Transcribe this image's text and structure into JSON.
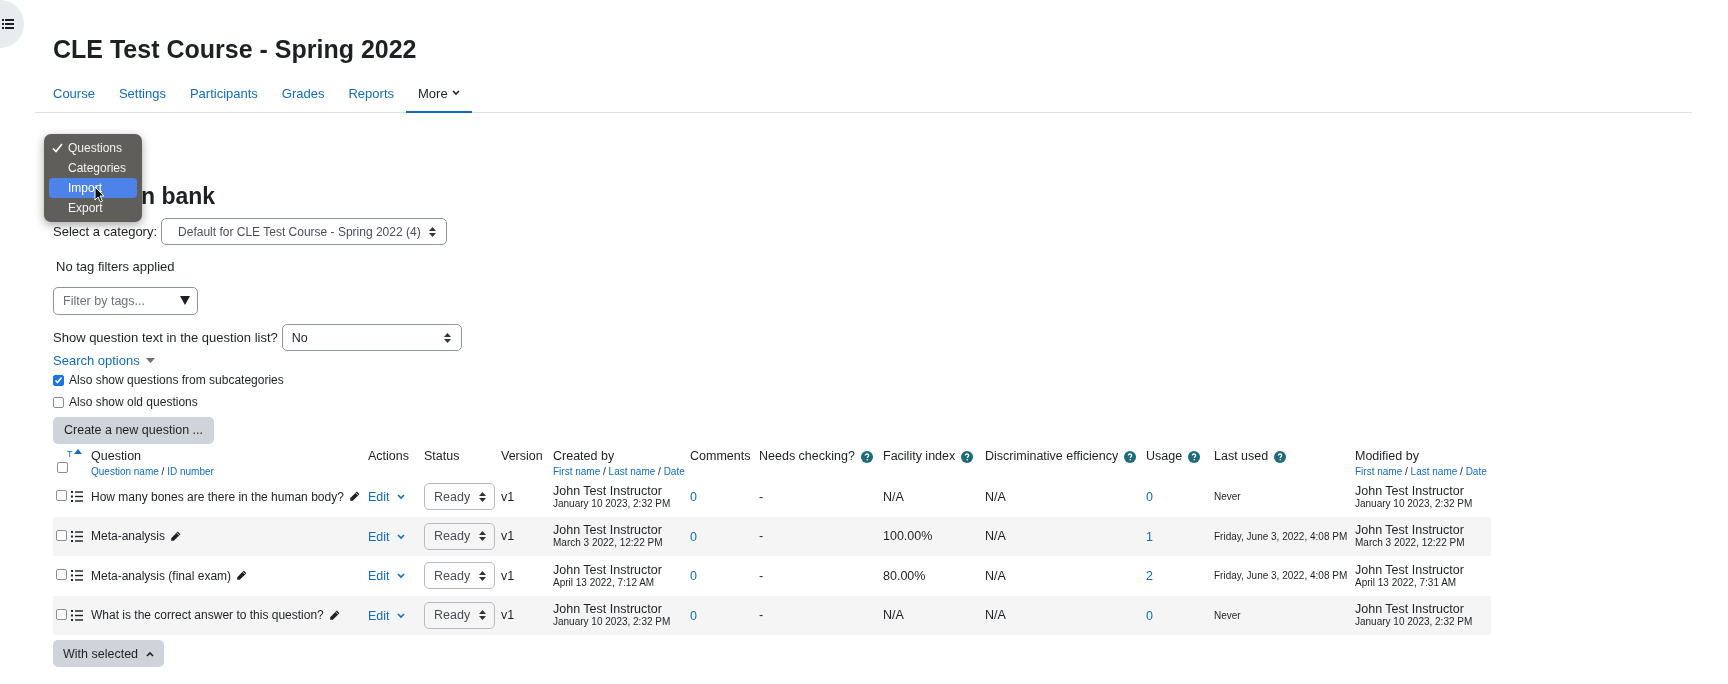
{
  "course_title": "CLE Test Course - Spring 2022",
  "nav_tabs": [
    {
      "label": "Course",
      "selected": false,
      "kind": "link"
    },
    {
      "label": "Settings",
      "selected": false,
      "kind": "link"
    },
    {
      "label": "Participants",
      "selected": false,
      "kind": "link"
    },
    {
      "label": "Grades",
      "selected": false,
      "kind": "link"
    },
    {
      "label": "Reports",
      "selected": false,
      "kind": "link"
    },
    {
      "label": "More",
      "selected": true,
      "kind": "dropdown"
    }
  ],
  "page_menu": [
    {
      "label": "Questions",
      "checked": true,
      "selected": false
    },
    {
      "label": "Categories",
      "checked": false,
      "selected": false
    },
    {
      "label": "Import",
      "checked": false,
      "selected": true
    },
    {
      "label": "Export",
      "checked": false,
      "selected": false
    }
  ],
  "heading": "n bank",
  "category": {
    "label": "Select a category:",
    "value": "Default for CLE Test Course - Spring 2022 (4)"
  },
  "tag_filter_note": "No tag filters applied",
  "tag_filter": {
    "placeholder": "Filter by tags..."
  },
  "show_text": {
    "label": "Show question text in the question list?",
    "value": "No"
  },
  "search_options": "Search options",
  "options": [
    {
      "label": "Also show questions from subcategories",
      "checked": true
    },
    {
      "label": "Also show old questions",
      "checked": false
    }
  ],
  "create_button": "Create a new question ...",
  "table": {
    "sort_mark": "T",
    "all_checked": false,
    "separator": "/",
    "columns": [
      {
        "label": "Question",
        "sublinks": [
          "Question name",
          "ID number"
        ],
        "help": false
      },
      {
        "label": "Actions",
        "help": false
      },
      {
        "label": "Status",
        "help": false
      },
      {
        "label": "Version",
        "help": false
      },
      {
        "label": "Created by",
        "sublinks": [
          "First name",
          "Last name",
          "Date"
        ],
        "help": false
      },
      {
        "label": "Comments",
        "help": false
      },
      {
        "label": "Needs checking?",
        "help": true
      },
      {
        "label": "Facility index",
        "help": true
      },
      {
        "label": "Discriminative efficiency",
        "help": true
      },
      {
        "label": "Usage",
        "help": true
      },
      {
        "label": "Last used",
        "help": true
      },
      {
        "label": "Modified by",
        "sublinks": [
          "First name",
          "Last name",
          "Date"
        ],
        "help": false
      }
    ],
    "rows": [
      {
        "selected": false,
        "name": "How many bones are there in the human body?",
        "action": "Edit",
        "status": "Ready",
        "version": "v1",
        "created_name": "John Test Instructor",
        "created_date": "January 10 2023, 2:32 PM",
        "comments": "0",
        "needs_checking": "-",
        "facility": "N/A",
        "discrimination": "N/A",
        "usage": "0",
        "last_used": "Never",
        "modified_name": "John Test Instructor",
        "modified_date": "January 10 2023, 2:32 PM"
      },
      {
        "selected": false,
        "name": "Meta-analysis",
        "action": "Edit",
        "status": "Ready",
        "version": "v1",
        "created_name": "John Test Instructor",
        "created_date": "March 3 2022, 12:22 PM",
        "comments": "0",
        "needs_checking": "-",
        "facility": "100.00%",
        "discrimination": "N/A",
        "usage": "1",
        "last_used": "Friday, June 3, 2022, 4:08 PM",
        "modified_name": "John Test Instructor",
        "modified_date": "March 3 2022, 12:22 PM"
      },
      {
        "selected": false,
        "name": "Meta-analysis (final exam)",
        "action": "Edit",
        "status": "Ready",
        "version": "v1",
        "created_name": "John Test Instructor",
        "created_date": "April 13 2022, 7:12 AM",
        "comments": "0",
        "needs_checking": "-",
        "facility": "80.00%",
        "discrimination": "N/A",
        "usage": "2",
        "last_used": "Friday, June 3, 2022, 4:08 PM",
        "modified_name": "John Test Instructor",
        "modified_date": "April 13 2022, 7:31 AM"
      },
      {
        "selected": false,
        "name": "What is the correct answer to this question?",
        "action": "Edit",
        "status": "Ready",
        "version": "v1",
        "created_name": "John Test Instructor",
        "created_date": "January 10 2023, 2:32 PM",
        "comments": "0",
        "needs_checking": "-",
        "facility": "N/A",
        "discrimination": "N/A",
        "usage": "0",
        "last_used": "Never",
        "modified_name": "John Test Instructor",
        "modified_date": "January 10 2023, 2:32 PM"
      }
    ]
  },
  "with_selected": "With selected"
}
